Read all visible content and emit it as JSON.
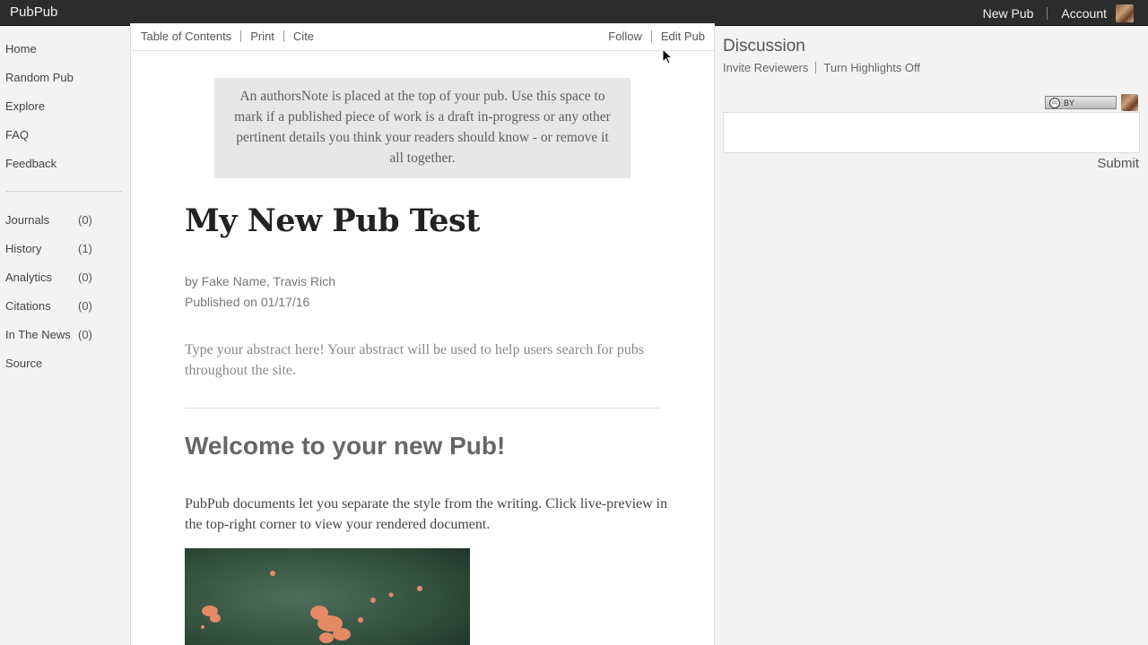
{
  "topbar": {
    "brand": "PubPub",
    "new_pub": "New Pub",
    "account": "Account"
  },
  "sidebar": {
    "nav": [
      "Home",
      "Random Pub",
      "Explore",
      "FAQ",
      "Feedback"
    ],
    "sections": [
      {
        "label": "Journals",
        "count": "(0)"
      },
      {
        "label": "History",
        "count": "(1)"
      },
      {
        "label": "Analytics",
        "count": "(0)"
      },
      {
        "label": "Citations",
        "count": "(0)"
      },
      {
        "label": "In The News",
        "count": "(0)"
      },
      {
        "label": "Source",
        "count": ""
      }
    ]
  },
  "subnav": {
    "toc": "Table of Contents",
    "print": "Print",
    "cite": "Cite",
    "follow": "Follow",
    "edit": "Edit Pub"
  },
  "pub": {
    "authors_note": "An authorsNote is placed at the top of your pub. Use this space to mark if a published piece of work is a draft in-progress or any other pertinent details you think your readers should know - or remove it all together.",
    "title": "My New Pub Test",
    "byline": "by Fake Name, Travis Rich",
    "published": "Published on 01/17/16",
    "abstract": "Type your abstract here! Your abstract will be used to help users search for pubs throughout the site.",
    "heading": "Welcome to your new Pub!",
    "body": "PubPub documents let you separate the style from the writing. Click live-preview in the top-right corner to view your rendered document."
  },
  "discussion": {
    "title": "Discussion",
    "invite": "Invite Reviewers",
    "highlights": "Turn Highlights Off",
    "license_badge": "BY",
    "license_cc": "cc",
    "input_value": "",
    "submit": "Submit"
  },
  "icons": {
    "user_avatar": "avatar-icon",
    "license": "cc-by-license-icon",
    "cursor": "mouse-pointer-icon"
  }
}
